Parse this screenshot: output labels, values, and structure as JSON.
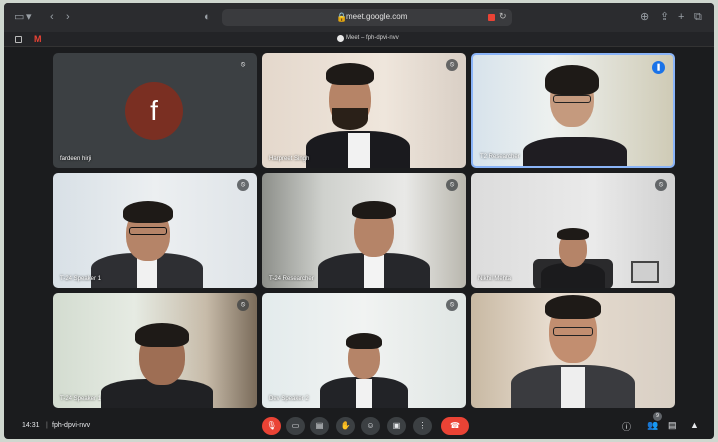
{
  "browser": {
    "url": "meet.google.com",
    "tab_title": "Meet – fph-dpvi-nvv"
  },
  "tiles": [
    {
      "name": "fardeen hirji",
      "avatar_letter": "f"
    },
    {
      "name": "Harpreet Singh"
    },
    {
      "name": "T2 Researcher"
    },
    {
      "name": "T-24 Speaker 1"
    },
    {
      "name": "T-24 Researcher"
    },
    {
      "name": "Nikhil Mehta"
    },
    {
      "name": "T-24 Speaker 1"
    },
    {
      "name": "Dev Speaker 2"
    },
    {
      "name": ""
    }
  ],
  "bottom_bar": {
    "time": "14:31",
    "meeting_code": "fph-dpvi-nvv",
    "people_count": "9"
  },
  "colors": {
    "accent": "#1a73e8",
    "hangup": "#ea4335",
    "background": "#1b1c1e"
  }
}
